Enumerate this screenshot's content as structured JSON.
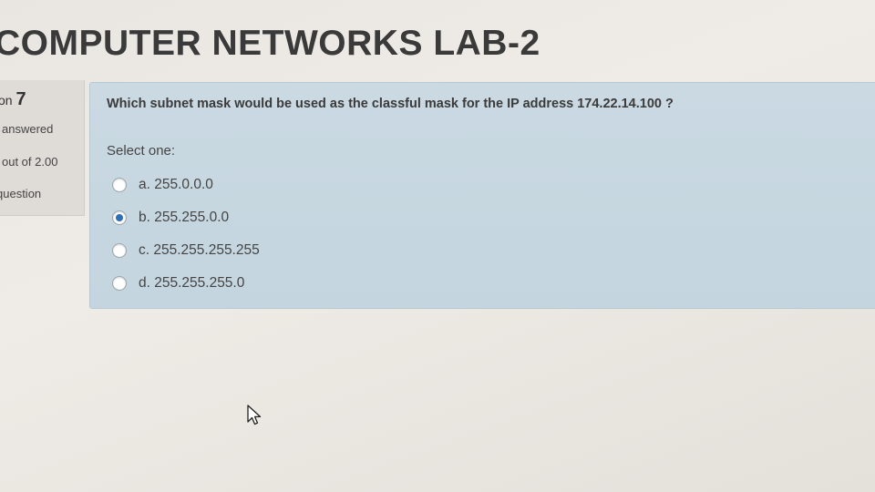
{
  "page": {
    "title": "COMPUTER NETWORKS LAB-2"
  },
  "question_info": {
    "prefix": "on",
    "number": "7",
    "state": "answered",
    "grade": "out of 2.00",
    "flag_label": "question"
  },
  "question": {
    "text": "Which subnet mask would be used as the classful mask for the IP address 174.22.14.100 ?",
    "prompt": "Select one:",
    "answers": [
      {
        "label": "a. 255.0.0.0",
        "selected": false
      },
      {
        "label": "b. 255.255.0.0",
        "selected": true
      },
      {
        "label": "c. 255.255.255.255",
        "selected": false
      },
      {
        "label": "d. 255.255.255.0",
        "selected": false
      }
    ]
  },
  "colors": {
    "accent": "#2f6fb5",
    "question_bg": "#c6d6e0"
  },
  "icons": {
    "cursor": "pointer-cursor-icon"
  }
}
